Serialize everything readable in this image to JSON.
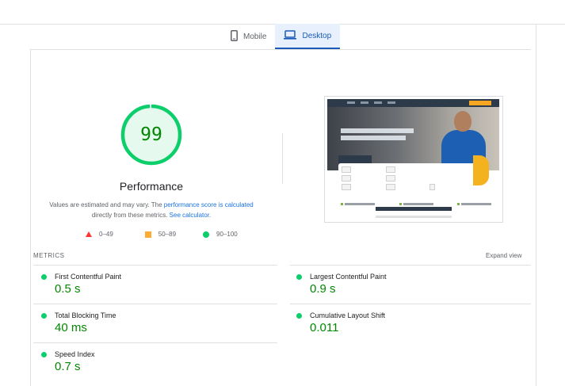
{
  "tabs": [
    {
      "label": "Mobile",
      "icon": "smartphone-icon",
      "active": false
    },
    {
      "label": "Desktop",
      "icon": "laptop-icon",
      "active": true
    }
  ],
  "score": {
    "value": "99",
    "title": "Performance",
    "description_prefix": "Values are estimated and may vary. The ",
    "description_link": "performance score is calculated",
    "description_mid": " directly from these metrics. ",
    "description_link2": "See calculator.",
    "fraction": 0.99,
    "color": "#0cce6b"
  },
  "legend": [
    {
      "range": "0–49",
      "shape": "triangle",
      "color": "#ff3333"
    },
    {
      "range": "50–89",
      "shape": "square",
      "color": "#ffaa33"
    },
    {
      "range": "90–100",
      "shape": "circle",
      "color": "#0cce6b"
    }
  ],
  "metrics": {
    "heading": "METRICS",
    "expand_label": "Expand view",
    "items": [
      {
        "label": "First Contentful Paint",
        "value": "0.5 s"
      },
      {
        "label": "Largest Contentful Paint",
        "value": "0.9 s"
      },
      {
        "label": "Total Blocking Time",
        "value": "40 ms"
      },
      {
        "label": "Cumulative Layout Shift",
        "value": "0.011"
      },
      {
        "label": "Speed Index",
        "value": "0.7 s"
      }
    ]
  }
}
